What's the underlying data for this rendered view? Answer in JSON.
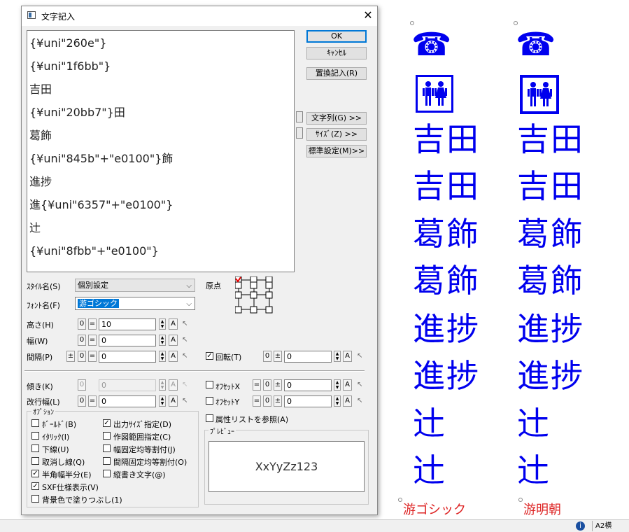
{
  "dialog": {
    "title": "文字記入",
    "close": "✕",
    "text_lines": [
      "{¥uni\"260e\"}",
      "{¥uni\"1f6bb\"}",
      "吉田",
      "{¥uni\"20bb7\"}田",
      "葛飾",
      "{¥uni\"845b\"+\"e0100\"}飾",
      "進捗",
      "進{¥uni\"6357\"+\"e0100\"}",
      "辻",
      "{¥uni\"8fbb\"+\"e0100\"}"
    ],
    "buttons": {
      "ok": "OK",
      "cancel": "ｷｬﾝｾﾙ",
      "replace": "置換記入(R)",
      "string": "文字列(G) >>",
      "size": "ｻｲｽﾞ(Z) >>",
      "standard": "標準設定(M)>>"
    },
    "style_label": "ｽﾀｲﾙ名(S)",
    "style_value": "個別設定",
    "font_label": "ﾌｫﾝﾄ名(F)",
    "font_value": "游ゴシック",
    "origin_label": "原点",
    "height_label": "高さ(H)",
    "width_label": "幅(W)",
    "spacing_label": "間隔(P)",
    "slant_label": "傾き(K)",
    "linewidth_label": "改行幅(L)",
    "height_value": "10",
    "width_value": "0",
    "spacing_value": "0",
    "slant_value": "0",
    "linewidth_value": "0",
    "rotate_label": "回転(T)",
    "rotate_value": "0",
    "offx_label": "ｵﾌｾｯﾄX",
    "offx_value": "0",
    "offy_label": "ｵﾌｾｯﾄY",
    "offy_value": "0",
    "attr_label": "属性リストを参照(A)",
    "options_title": "ｵﾌﾟｼｮﾝ",
    "options_left": [
      {
        "label": "ﾎﾞｰﾙﾄﾞ(B)",
        "checked": false
      },
      {
        "label": "ｲﾀﾘｯｸ(I)",
        "checked": false
      },
      {
        "label": "下線(U)",
        "checked": false
      },
      {
        "label": "取消し線(Q)",
        "checked": false
      },
      {
        "label": "半角幅半分(E)",
        "checked": true
      },
      {
        "label": "SXF仕様表示(V)",
        "checked": true
      },
      {
        "label": "背景色で塗りつぶし(1)",
        "checked": false
      }
    ],
    "options_right": [
      {
        "label": "出力ｻｲｽﾞ指定(D)",
        "checked": true
      },
      {
        "label": "作図範囲指定(C)",
        "checked": false
      },
      {
        "label": "幅固定均等割付(J)",
        "checked": false
      },
      {
        "label": "間隔固定均等割付(O)",
        "checked": false
      },
      {
        "label": "縦書き文字(@)",
        "checked": false
      }
    ],
    "preview_title": "ﾌﾟﾚﾋﾞｭｰ",
    "preview_text": "XxYyZz123",
    "sym_zero": "0",
    "sym_eq": "=",
    "sym_pm": "±",
    "sym_a": "A"
  },
  "canvas": {
    "columns": [
      {
        "font_label": "游ゴシック",
        "glyphs": [
          "☎",
          "🚻",
          "吉田",
          "吉田",
          "葛飾",
          "葛飾",
          "進捗",
          "進捗",
          "辻",
          "辻"
        ]
      },
      {
        "font_label": "游明朝",
        "glyphs": [
          "☎",
          "🚻",
          "吉田",
          "吉田",
          "葛飾",
          "葛飾",
          "進捗",
          "進捗",
          "辻",
          "辻"
        ]
      }
    ]
  },
  "statusbar": {
    "paper": "A2横",
    "info_icon": "i"
  }
}
